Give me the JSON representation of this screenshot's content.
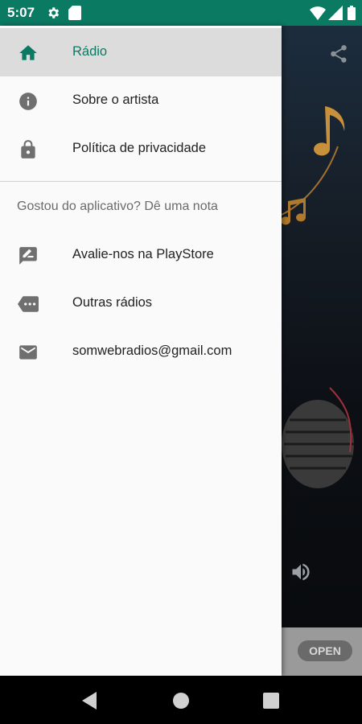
{
  "status_bar": {
    "time": "5:07",
    "icons": [
      "gear-icon",
      "sd-card-icon",
      "wifi-icon",
      "signal-icon",
      "battery-icon"
    ]
  },
  "drawer": {
    "items": [
      {
        "label": "Rádio",
        "icon": "home-icon",
        "selected": true
      },
      {
        "label": "Sobre o artista",
        "icon": "info-icon"
      },
      {
        "label": "Política de privacidade",
        "icon": "lock-icon"
      }
    ],
    "section_title": "Gostou do aplicativo? Dê uma nota",
    "section_items": [
      {
        "label": "Avalie-nos na PlayStore",
        "icon": "rate-review-icon"
      },
      {
        "label": "Outras rádios",
        "icon": "label-more-icon"
      },
      {
        "label": "somwebradios@gmail.com",
        "icon": "email-icon"
      }
    ]
  },
  "background_app": {
    "ad_button_label": "OPEN"
  },
  "colors": {
    "accent": "#0a7a63",
    "drawer_bg": "#fafafa",
    "selected_bg": "#dcdcdc",
    "icon_gray": "#6f6f6f"
  },
  "nav_bar": {
    "buttons": [
      "back-icon",
      "home-circle-icon",
      "recents-icon"
    ]
  }
}
